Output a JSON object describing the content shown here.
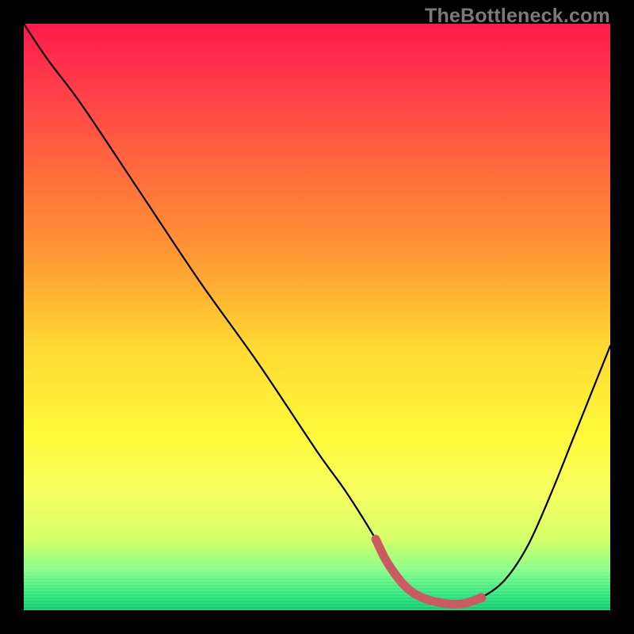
{
  "watermark": "TheBottleneck.com",
  "colors": {
    "frame": "#000000",
    "curve": "#000000",
    "marker": "#cc5a63",
    "gradient_top": "#ff1a4d",
    "gradient_bottom": "#13c76c"
  },
  "chart_data": {
    "type": "line",
    "title": "",
    "xlabel": "",
    "ylabel": "",
    "xlim": [
      0,
      100
    ],
    "ylim": [
      0,
      100
    ],
    "x": [
      0,
      4,
      10,
      20,
      30,
      40,
      50,
      55,
      60,
      62,
      65,
      68,
      72,
      75,
      78,
      82,
      86,
      90,
      94,
      98,
      100
    ],
    "values": [
      100,
      94,
      86,
      71,
      56,
      42,
      27,
      20,
      12,
      8,
      4,
      2,
      1,
      1,
      2,
      5,
      11,
      20,
      30,
      40,
      45
    ],
    "highlight_range": {
      "x_start": 60,
      "x_end": 78
    },
    "annotations": []
  }
}
